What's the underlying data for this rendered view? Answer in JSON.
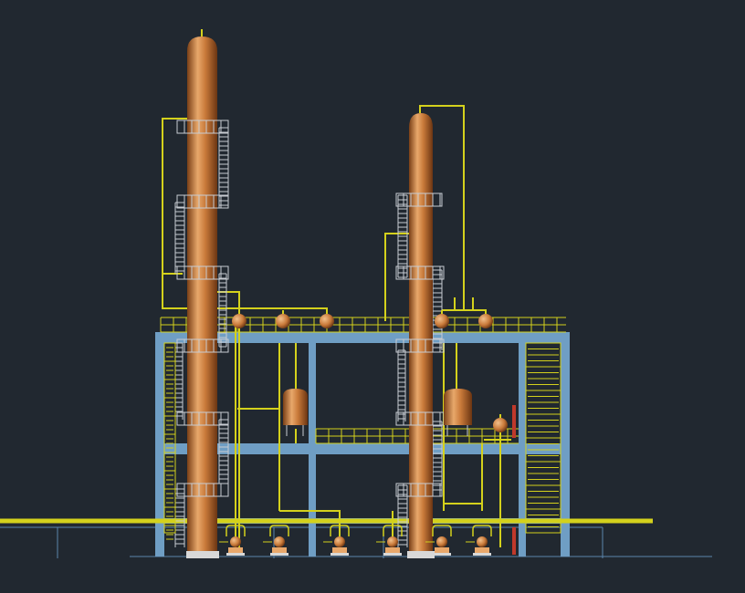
{
  "scene": {
    "subject": "distillation-unit-elevation",
    "colors": {
      "background": "#212830",
      "structure_steel": "#6f9ec4",
      "piping": "#d4d11c",
      "copper_light": "#e8a86b",
      "copper_mid": "#c97a3a",
      "copper_dark": "#7a3f16",
      "ladder": "#c8ccd2",
      "ground_line": "#5b86ad",
      "red_accent": "#c0392b"
    },
    "icons": [
      "distillation-column-icon",
      "pump-icon",
      "tank-icon",
      "ladder-icon"
    ]
  }
}
